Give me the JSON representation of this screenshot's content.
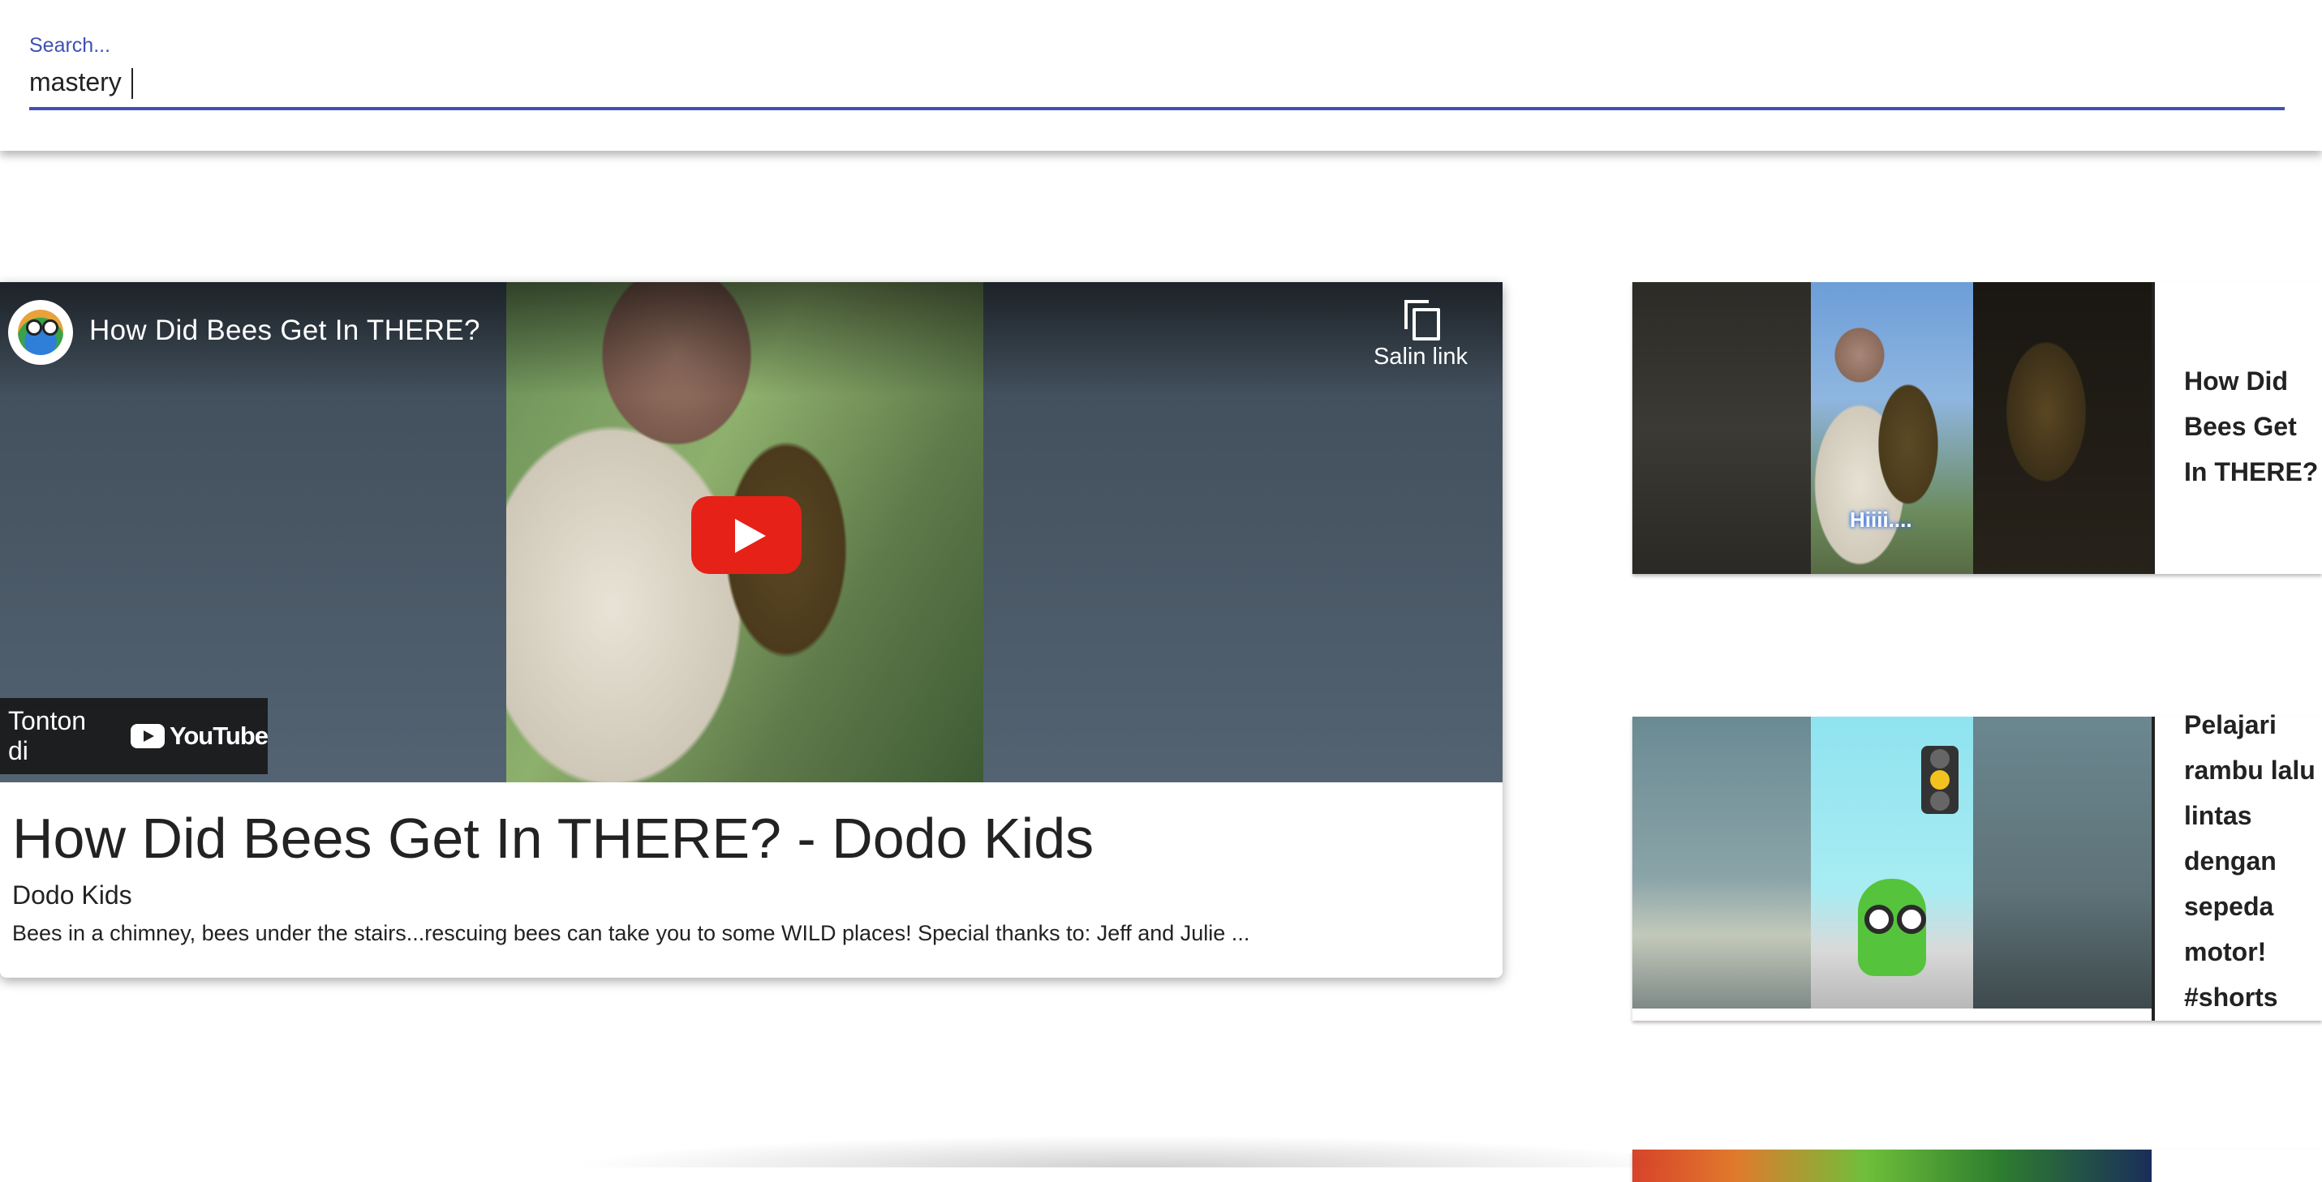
{
  "search": {
    "label": "Search...",
    "value": "mastery "
  },
  "main_video": {
    "overlay_title": "How Did Bees Get In THERE?",
    "copy_link_label": "Salin link",
    "watch_on_label": "Tonton di",
    "youtube_logo_text": "YouTube",
    "title": "How Did Bees Get In THERE? - Dodo Kids",
    "channel": "Dodo Kids",
    "description": "Bees in a chimney, bees under the stairs...rescuing bees can take you to some WILD places! Special thanks to: Jeff and Julie ..."
  },
  "related_videos": [
    {
      "title": "How Did Bees Get In THERE?",
      "thumbnail_caption": "Hiiii...."
    },
    {
      "title": "Pelajari rambu lalu lintas dengan sepeda motor! #shorts"
    }
  ],
  "colors": {
    "accent": "#3f51b5",
    "youtube_red": "#e62117"
  },
  "icons": [
    "channel-avatar-icon",
    "copy-link-icon",
    "play-icon",
    "youtube-logo-icon"
  ]
}
